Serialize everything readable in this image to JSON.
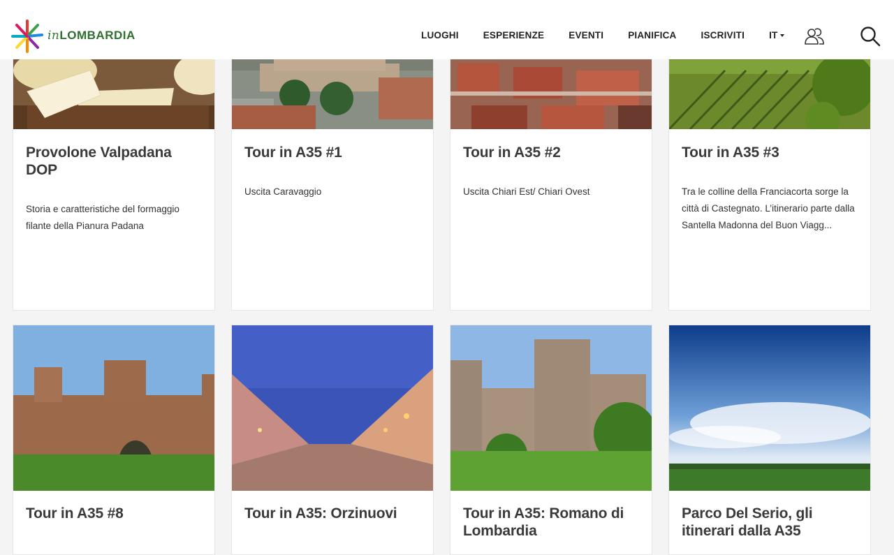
{
  "brand": {
    "prefix": "in",
    "name": "LOMBARDIA"
  },
  "nav": {
    "items": [
      "LUOGHI",
      "ESPERIENZE",
      "EVENTI",
      "PIANIFICA",
      "ISCRIVITI"
    ],
    "language": "IT"
  },
  "cards": [
    {
      "title": "Provolone Valpadana DOP",
      "description": "Storia e caratteristiche del formaggio filante della Pianura Padana"
    },
    {
      "title": "Tour in A35 #1",
      "description": "Uscita Caravaggio"
    },
    {
      "title": "Tour in A35 #2",
      "description": "Uscita Chiari Est/ Chiari Ovest"
    },
    {
      "title": "Tour in A35 #3",
      "description": "Tra le colline della Franciacorta sorge la città di Castegnato. L’itinerario parte dalla Santella Madonna del Buon Viagg..."
    },
    {
      "title": "Tour in A35 #8",
      "description": ""
    },
    {
      "title": "Tour in A35: Orzinuovi",
      "description": ""
    },
    {
      "title": "Tour in A35: Romano di Lombardia",
      "description": ""
    },
    {
      "title": "Parco Del Serio, gli itinerari dalla A35",
      "description": ""
    }
  ],
  "colors": {
    "brand_green": "#2e7d32",
    "background": "#f4f4f4"
  }
}
